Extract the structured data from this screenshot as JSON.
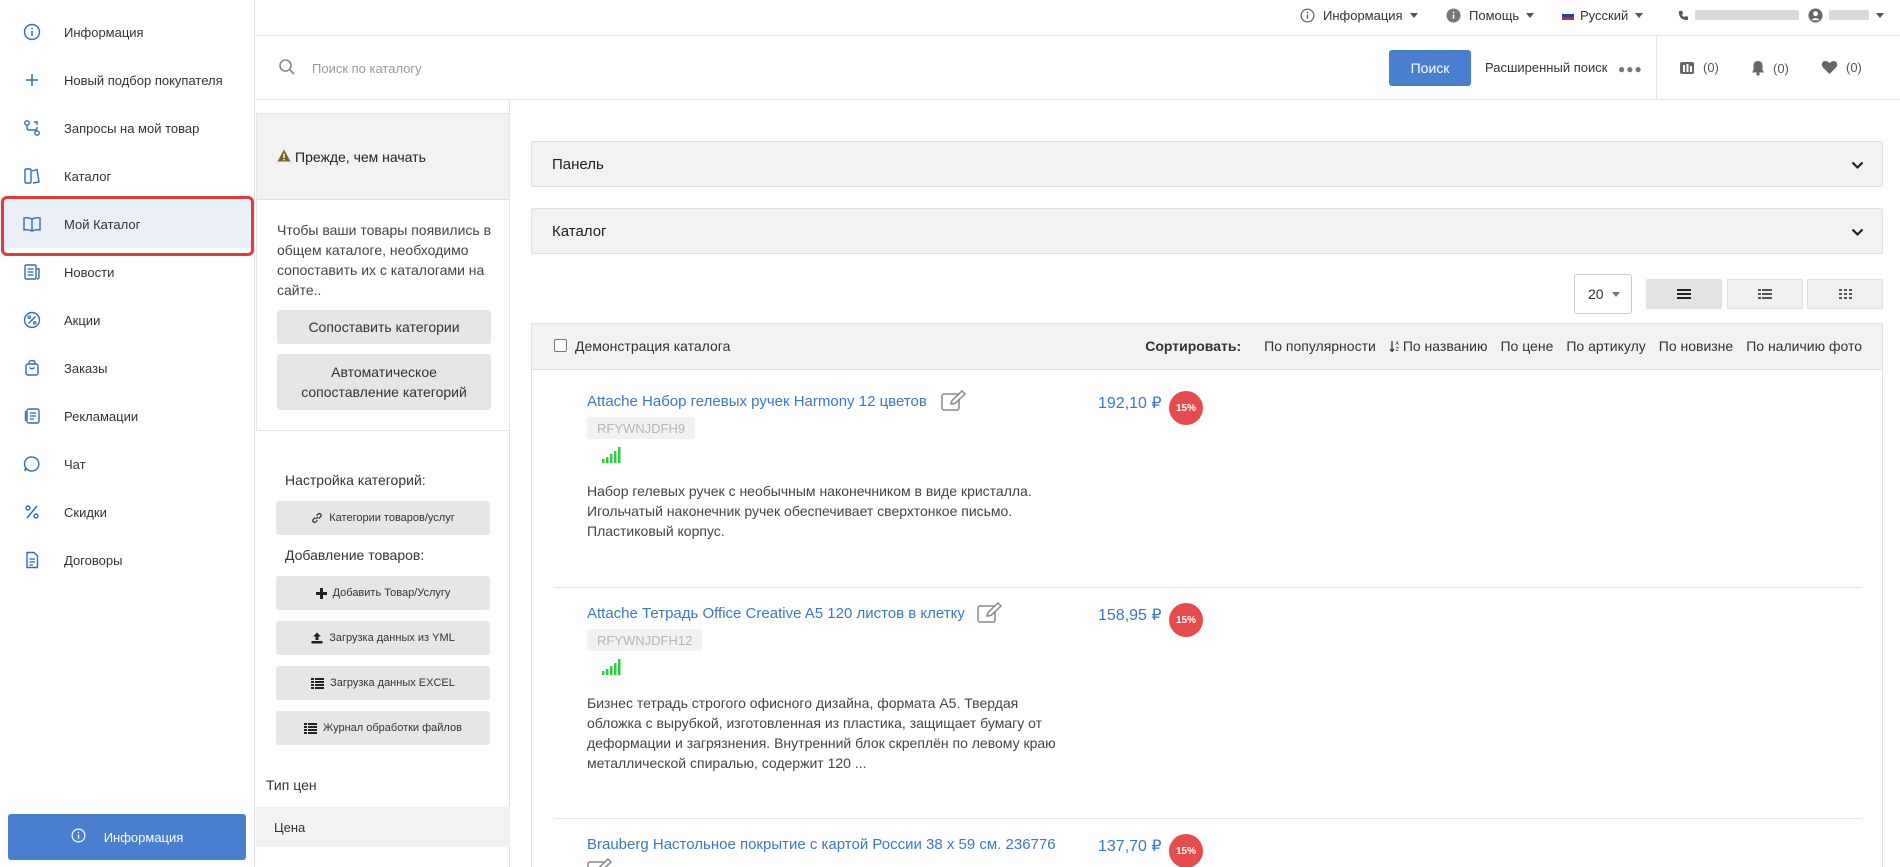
{
  "nav": {
    "items": [
      {
        "label": "Информация",
        "icon": "info-circle-icon"
      },
      {
        "label": "Новый подбор покупателя",
        "icon": "plus-icon"
      },
      {
        "label": "Запросы на мой товар",
        "icon": "route-icon"
      },
      {
        "label": "Каталог",
        "icon": "catalog-icon"
      },
      {
        "label": "Мой Каталог",
        "icon": "open-book-icon",
        "active": true
      },
      {
        "label": "Новости",
        "icon": "news-icon"
      },
      {
        "label": "Акции",
        "icon": "percent-circle-icon"
      },
      {
        "label": "Заказы",
        "icon": "shopping-bag-icon"
      },
      {
        "label": "Рекламации",
        "icon": "complaint-icon"
      },
      {
        "label": "Чат",
        "icon": "chat-icon"
      },
      {
        "label": "Скидки",
        "icon": "percent-icon"
      },
      {
        "label": "Договоры",
        "icon": "document-icon"
      }
    ],
    "bottom_button": "Информация"
  },
  "topbar": {
    "info": "Информация",
    "help": "Помощь",
    "language": "Русский"
  },
  "search": {
    "placeholder": "Поиск по каталогу",
    "button": "Поиск",
    "advanced": "Расширенный поиск",
    "counters": {
      "compare": "(0)",
      "notifications": "(0)",
      "favorites": "(0)"
    }
  },
  "sidepanel": {
    "warning_title": "Прежде, чем начать",
    "warning_text": "Чтобы ваши товары появились в общем каталоге, необходимо сопоставить их с каталогами на сайте..",
    "match_button": "Сопоставить категории",
    "auto_match_button": "Автоматическое сопоставление категорий",
    "settings_label": "Настройка категорий:",
    "categories_button": "Категории товаров/услуг",
    "add_label": "Добавление товаров:",
    "add_button": "Добавить Товар/Услугу",
    "yml_button": "Загрузка данных из YML",
    "excel_button": "Загрузка данных EXCEL",
    "log_button": "Журнал обработки файлов",
    "price_type_label": "Тип цен",
    "price_type_value": "Цена"
  },
  "main": {
    "accordions": [
      "Панель",
      "Каталог"
    ],
    "per_page": "20",
    "demo_label": "Демонстрация каталога",
    "sort_title": "Сортировать:",
    "sort_options": [
      "По популярности",
      "По названию",
      "По цене",
      "По артикулу",
      "По новизне",
      "По наличию фото"
    ],
    "products": [
      {
        "title": "Attache Набор гелевых ручек Harmony 12 цветов",
        "sku": "RFYWNJDFH9",
        "desc": "Набор гелевых ручек с необычным наконечником в виде кристалла. Игольчатый наконечник ручек обеспечивает сверхтонкое письмо. Пластиковый корпус.",
        "price": "192,10 ₽",
        "discount": "15%"
      },
      {
        "title": "Attache Тетрадь Office Creative A5 120 листов в клетку",
        "sku": "RFYWNJDFH12",
        "desc": "Бизнес тетрадь строгого офисного дизайна, формата А5. Твердая обложка с вырубкой, изготовленная из пластика, защищает бумагу от деформации и загрязнения. Внутренний блок скреплён по левому краю металлической спиралью, содержит 120 ...",
        "price": "158,95 ₽",
        "discount": "15%"
      },
      {
        "title": "Brauberg Настольное покрытие с картой России 38 х 59 см. 236776",
        "price": "137,70 ₽",
        "discount": "15%"
      }
    ]
  },
  "colors": {
    "accent": "#4a7fcf",
    "link": "#3b78c4",
    "badge": "#e74b4b",
    "highlight": "#e53935",
    "signal": "#2ecc40"
  }
}
